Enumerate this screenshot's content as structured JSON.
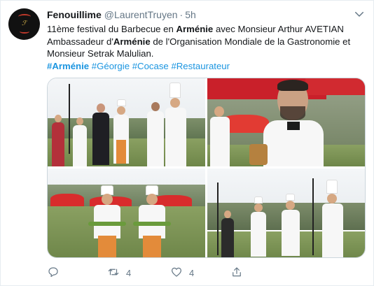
{
  "tweet": {
    "display_name": "Fenouillime",
    "handle": "@LaurentTruyen",
    "separator": "·",
    "time": "5h",
    "text_parts": {
      "p1": "11ème festival du Barbecue en ",
      "b1": "Arménie",
      "p2": " avec Monsieur Arthur AVETIAN Ambassadeur d'",
      "b2": "Arménie",
      "p3": " de l'Organisation Mondiale de la Gastronomie et Monsieur Setrak Malulian."
    },
    "hashtags": [
      "#Arménie",
      "#Géorgie",
      "#Cocase",
      "#Restaurateur"
    ],
    "media_icons": [
      "photo-festival-stage",
      "photo-man-portrait",
      "photo-chefs-grill",
      "photo-chefs-handshake"
    ],
    "actions": {
      "reply_count": "",
      "retweet_count": "4",
      "like_count": "4"
    },
    "colors": {
      "link": "#1b95e0",
      "text": "#14171a",
      "secondary": "#657786",
      "border": "#e6ecf0"
    }
  }
}
